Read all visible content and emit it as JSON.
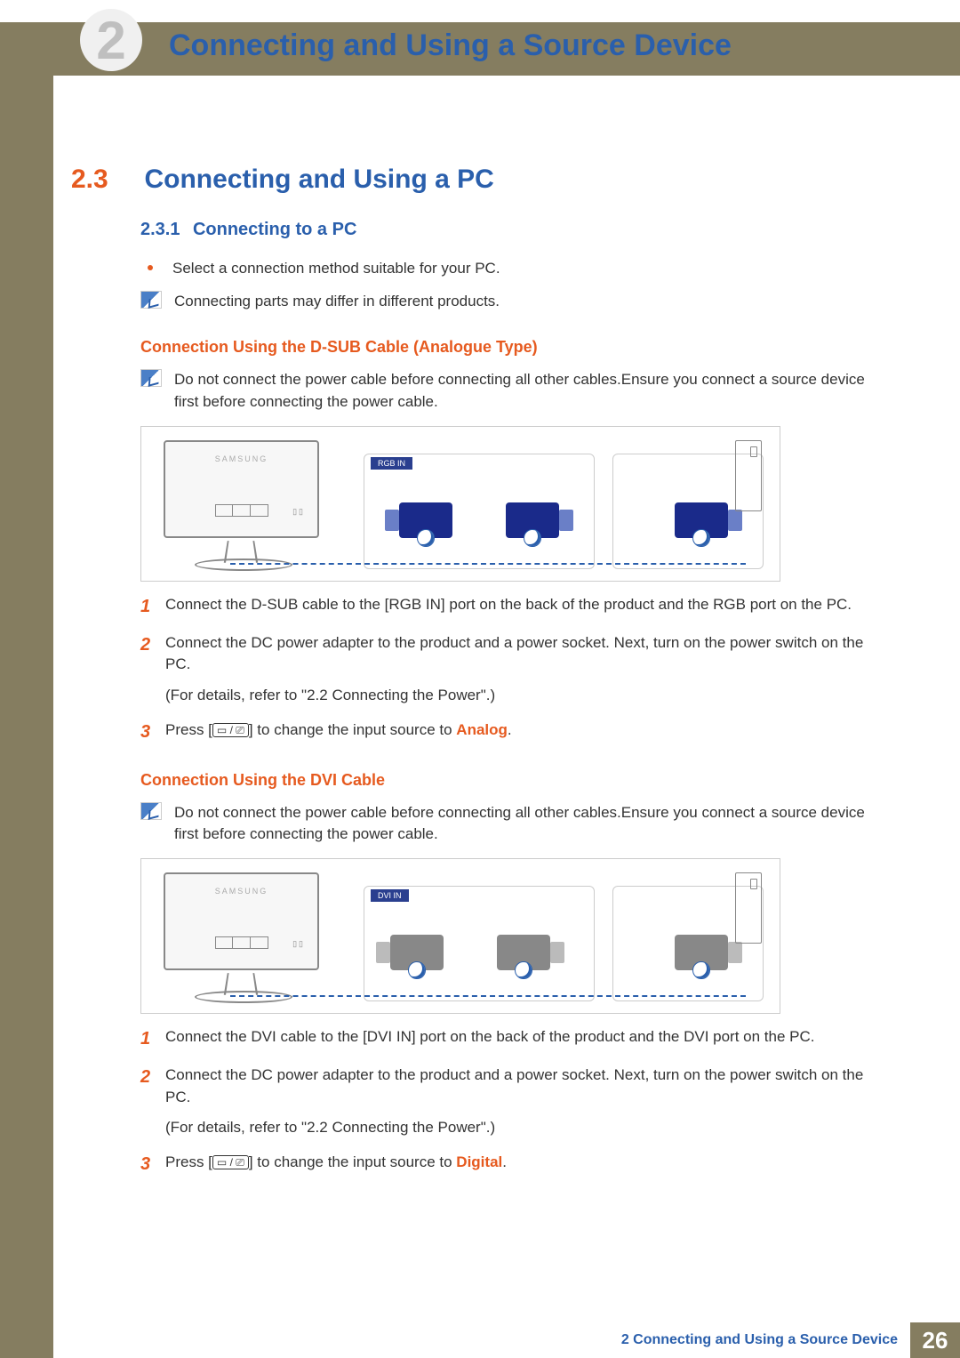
{
  "header": {
    "chapter_num": "2",
    "chapter_title": "Connecting and Using a Source Device"
  },
  "section": {
    "number": "2.3",
    "title": "Connecting and Using a PC"
  },
  "subsection": {
    "number": "2.3.1",
    "title": "Connecting to a PC"
  },
  "intro_bullet": "Select a connection method suitable for your PC.",
  "intro_note": "Connecting parts may differ in different products.",
  "dsub": {
    "heading": "Connection Using the D-SUB Cable (Analogue Type)",
    "note": "Do not connect the power cable before connecting all other cables.Ensure you connect a source device first before connecting the power cable.",
    "diagram": {
      "brand": "SAMSUNG",
      "port_label": "RGB IN"
    },
    "steps": [
      {
        "n": "1",
        "text": "Connect the D-SUB cable to the [RGB IN] port on the back of the product and the RGB port on the PC."
      },
      {
        "n": "2",
        "text": "Connect the DC power adapter to the product and a power socket. Next, turn on the power switch on the PC."
      }
    ],
    "step2_detail": "(For details, refer to \"2.2 Connecting the Power\".)",
    "step3": {
      "n": "3",
      "pre": "Press [",
      "sym": "▭ / ⎚",
      "mid": "] to change the input source to ",
      "src": "Analog",
      "post": "."
    }
  },
  "dvi": {
    "heading": "Connection Using the DVI Cable",
    "note": "Do not connect the power cable before connecting all other cables.Ensure you connect a source device first before connecting the power cable.",
    "diagram": {
      "brand": "SAMSUNG",
      "port_label": "DVI IN"
    },
    "steps": [
      {
        "n": "1",
        "text": "Connect the DVI cable to the [DVI IN] port on the back of the product and the DVI port on the PC."
      },
      {
        "n": "2",
        "text": "Connect the DC power adapter to the product and a power socket. Next, turn on the power switch on the PC."
      }
    ],
    "step2_detail": "(For details, refer to \"2.2 Connecting the Power\".)",
    "step3": {
      "n": "3",
      "pre": "Press [",
      "sym": "▭ / ⎚",
      "mid": "] to change the input source to ",
      "src": "Digital",
      "post": "."
    }
  },
  "footer": {
    "text": "2 Connecting and Using a Source Device",
    "page": "26"
  }
}
